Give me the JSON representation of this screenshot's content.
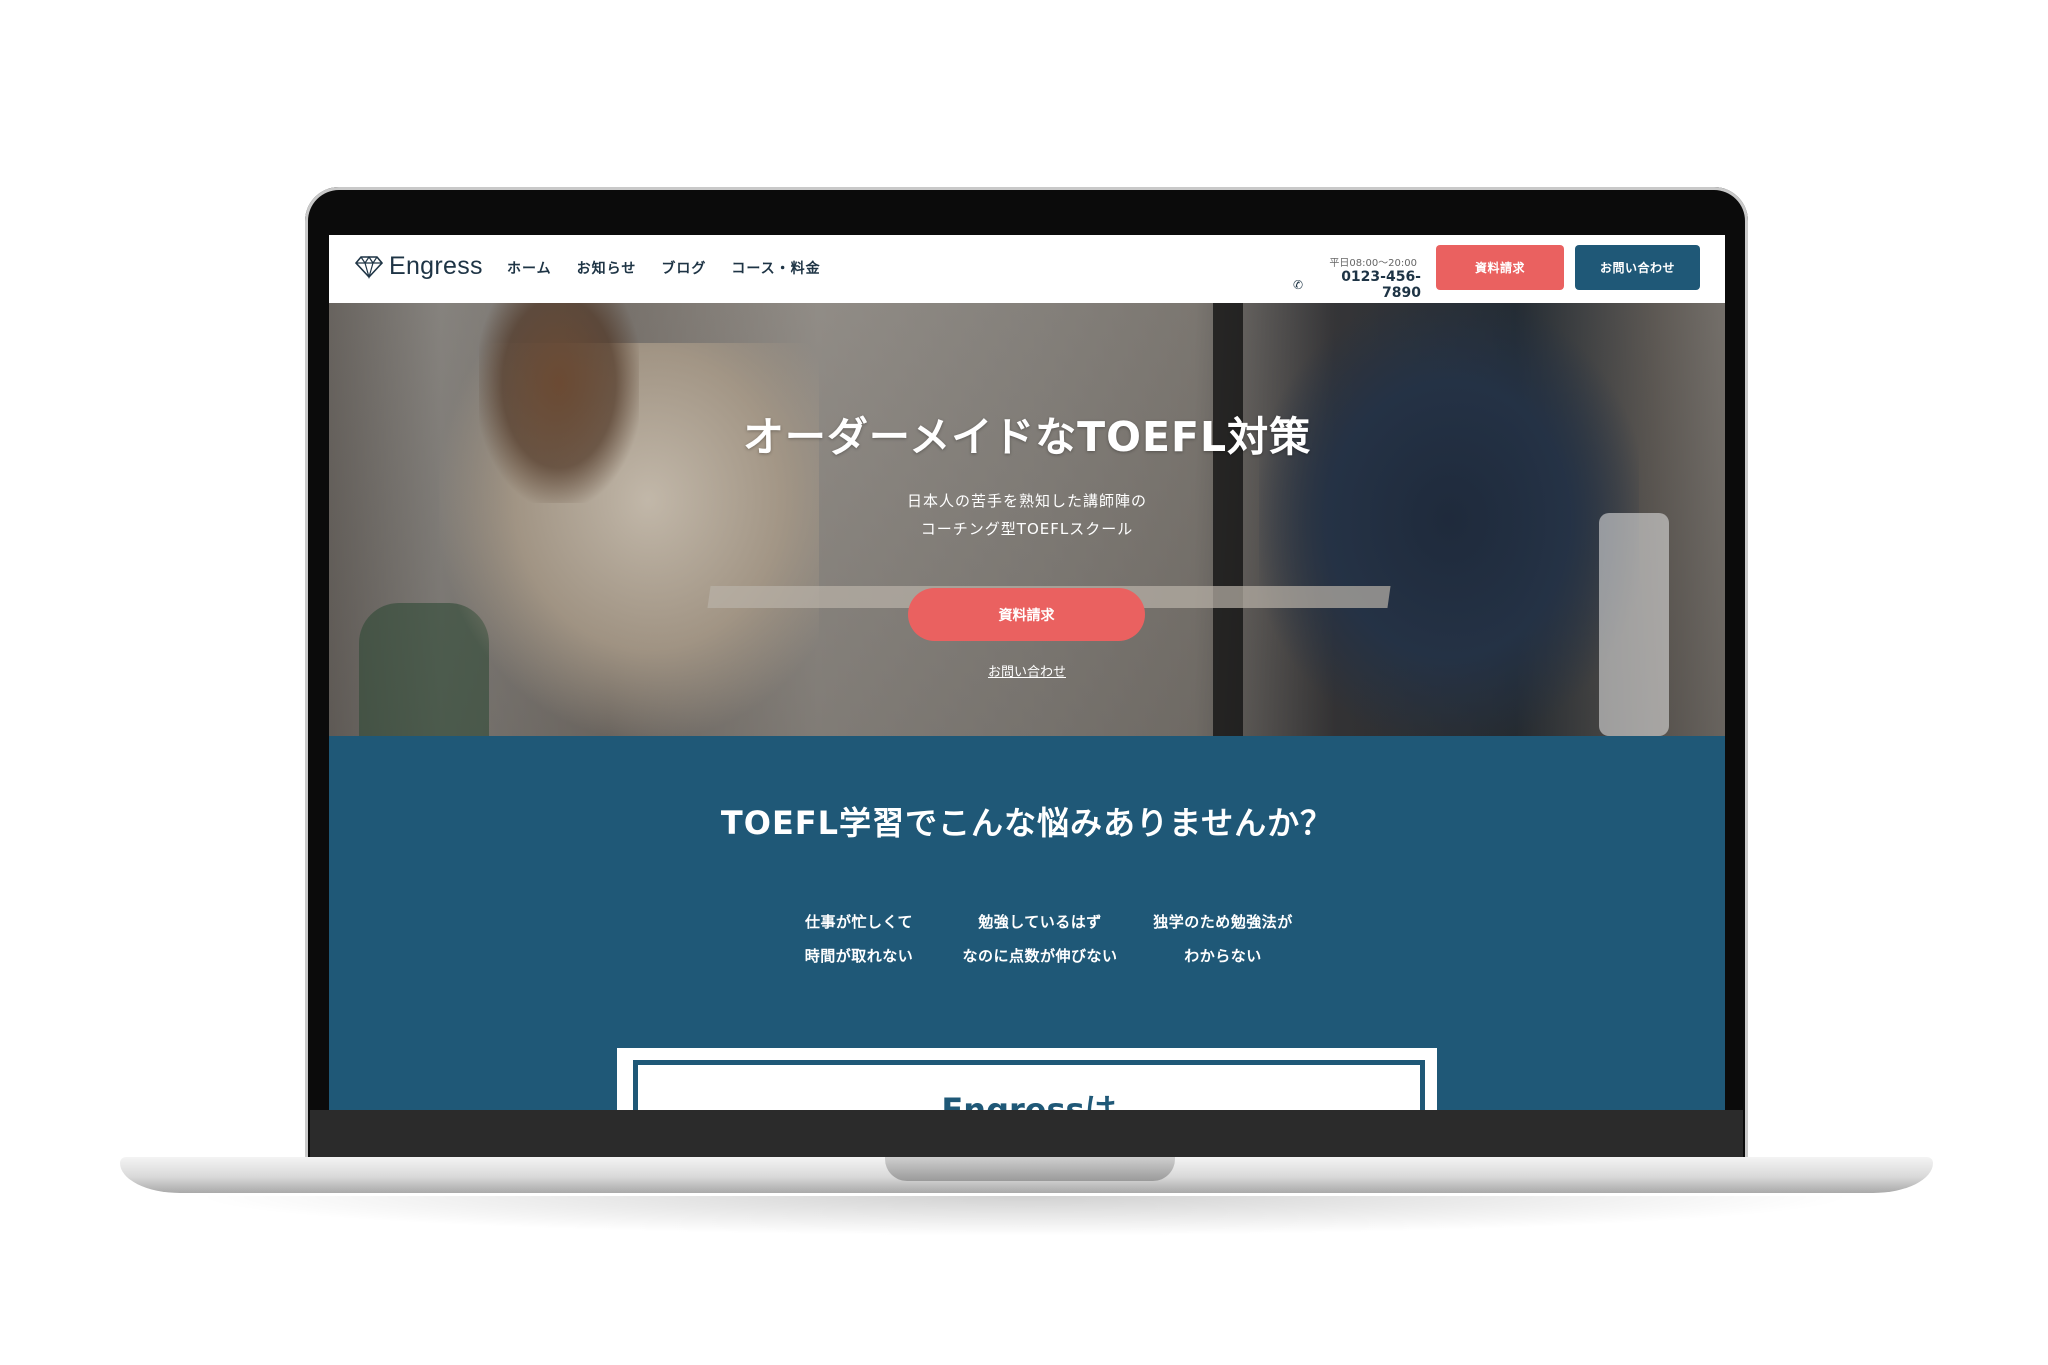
{
  "header": {
    "logo_text": "Engress",
    "nav": [
      "ホーム",
      "お知らせ",
      "ブログ",
      "コース・料金"
    ],
    "hours": "平日08:00〜20:00",
    "phone": "0123-456-7890",
    "btn_doc": "資料請求",
    "btn_contact": "お問い合わせ"
  },
  "hero": {
    "title": "オーダーメイドなTOEFL対策",
    "sub1": "日本人の苦手を熟知した講師陣の",
    "sub2": "コーチング型TOEFLスクール",
    "cta": "資料請求",
    "link": "お問い合わせ"
  },
  "issues": {
    "title": "TOEFL学習でこんな悩みありませんか？",
    "items": [
      {
        "line1": "仕事が忙しくて",
        "line2": "時間が取れない"
      },
      {
        "line1": "勉強しているはず",
        "line2": "なのに点数が伸びない"
      },
      {
        "line1": "独学のため勉強法が",
        "line2": "わからない"
      }
    ]
  },
  "about": {
    "title": "Engressは"
  },
  "colors": {
    "accent": "#ea6160",
    "brand": "#1f5877"
  },
  "icons": {
    "logo": "diamond-icon",
    "phone": "phone-icon"
  }
}
